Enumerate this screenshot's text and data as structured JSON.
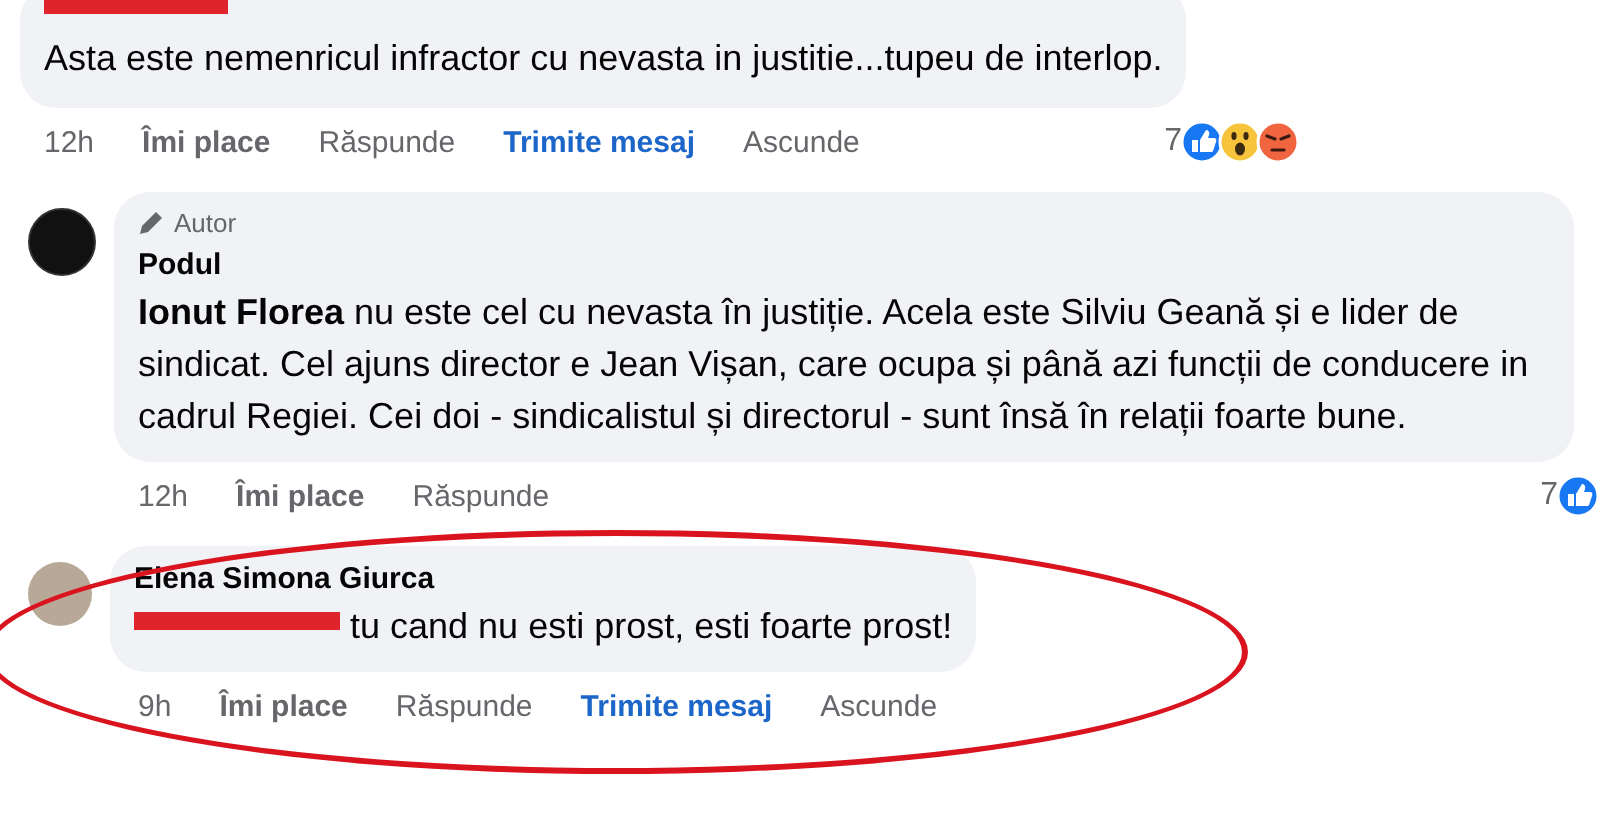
{
  "comments": [
    {
      "author_redacted": true,
      "mention_redacted": false,
      "text": "Asta este nemenricul infractor cu nevasta in justitie...tupeu de interlop.",
      "highlighted": false,
      "actions": [
        {
          "kind": "time",
          "label": "12h"
        },
        {
          "kind": "like",
          "label": "Îmi place"
        },
        {
          "kind": "reply",
          "label": "Răspunde"
        },
        {
          "kind": "message",
          "label": "Trimite mesaj"
        },
        {
          "kind": "hide",
          "label": "Ascunde"
        }
      ],
      "reactions": {
        "count": "7",
        "icons": [
          {
            "kind": "like"
          },
          {
            "kind": "wow"
          },
          {
            "kind": "angry"
          }
        ]
      }
    },
    {
      "avatar": {
        "kind": "logo"
      },
      "author": "Podul",
      "author_redacted": false,
      "badge": "Autor",
      "mention_redacted": false,
      "text": "**Ionut Florea** nu este cel cu nevasta în justiție. Acela este Silviu Geană și e lider de sindicat. Cel ajuns director e Jean Vișan, care ocupa și până azi funcții de conducere in cadrul Regiei. Cei doi - sindicalistul și directorul - sunt însă în relații foarte bune.",
      "highlighted": false,
      "actions": [
        {
          "kind": "time",
          "label": "12h"
        },
        {
          "kind": "like",
          "label": "Îmi place"
        },
        {
          "kind": "reply",
          "label": "Răspunde"
        }
      ],
      "reactions": {
        "count": "7",
        "icons": [
          {
            "kind": "like"
          }
        ]
      }
    },
    {
      "avatar": {
        "kind": "photo"
      },
      "author": "Elena Simona Giurca",
      "author_redacted": false,
      "mention_redacted": true,
      "text": "tu cand nu esti prost, esti foarte prost!",
      "highlighted": true,
      "actions": [
        {
          "kind": "time",
          "label": "9h"
        },
        {
          "kind": "like",
          "label": "Îmi place"
        },
        {
          "kind": "reply",
          "label": "Răspunde"
        },
        {
          "kind": "message",
          "label": "Trimite mesaj"
        },
        {
          "kind": "hide",
          "label": "Ascunde"
        }
      ]
    }
  ]
}
